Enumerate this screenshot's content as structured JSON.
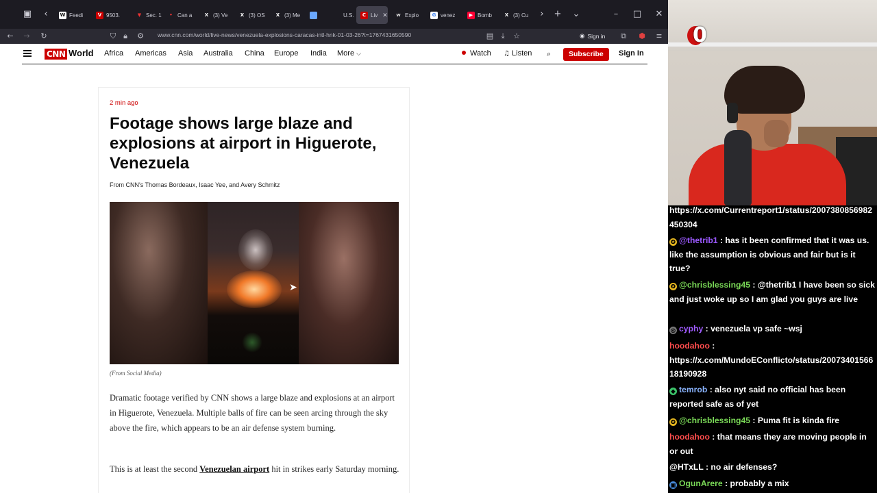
{
  "tabs": [
    {
      "label": "Feedi",
      "fav": "W",
      "color": "#ffffff",
      "fg": "#111"
    },
    {
      "label": "9503.",
      "fav": "V",
      "color": "#cc0000",
      "fg": "#fff"
    },
    {
      "label": "Sec. 1",
      "fav": "▼",
      "color": "#1c1b22",
      "fg": "#e33"
    },
    {
      "label": "Can a",
      "fav": "•",
      "color": "#1c1b22",
      "fg": "#e33"
    },
    {
      "label": "(3) Ve",
      "fav": "X",
      "color": "#1c1b22",
      "fg": "#fff"
    },
    {
      "label": "(3) OS",
      "fav": "X",
      "color": "#1c1b22",
      "fg": "#fff"
    },
    {
      "label": "(3) Me",
      "fav": "X",
      "color": "#1c1b22",
      "fg": "#fff"
    },
    {
      "label": "",
      "fav": "",
      "color": "#6aa8ff",
      "fg": "#fff"
    },
    {
      "label": "U.S. la",
      "fav": "",
      "color": "#1c1b22",
      "fg": "#fff"
    },
    {
      "label": "Liv",
      "fav": "C",
      "color": "#cc0000",
      "fg": "#fff"
    },
    {
      "label": "Explo",
      "fav": "w",
      "color": "#1c1b22",
      "fg": "#ddd"
    },
    {
      "label": "venez",
      "fav": "G",
      "color": "#ffffff",
      "fg": "#4285f4"
    },
    {
      "label": "Bomb",
      "fav": "▶",
      "color": "#ff0033",
      "fg": "#fff"
    },
    {
      "label": "(3) Cu",
      "fav": "X",
      "color": "#1c1b22",
      "fg": "#fff"
    }
  ],
  "url": "www.cnn.com/world/live-news/venezuela-explosions-caracas-intl-hnk-01-03-26?t=1767431650590",
  "browser_signin": "Sign in",
  "nav": {
    "logo": "CNN",
    "section": "World",
    "links": [
      "Africa",
      "Americas",
      "Asia",
      "Australia",
      "China",
      "Europe",
      "India",
      "More"
    ],
    "watch": "Watch",
    "listen": "Listen",
    "subscribe": "Subscribe",
    "sign_in": "Sign In"
  },
  "article": {
    "timestamp": "2 min ago",
    "headline": "Footage shows large blaze and explosions at airport in Higuerote, Venezuela",
    "byline": "From CNN's Thomas Bordeaux, Isaac Yee, and Avery Schmitz",
    "caption": "(From Social Media)",
    "para1": "Dramatic footage verified by CNN shows a large blaze and explosions at an airport in Higuerote, Venezuela. Multiple balls of fire can be seen arcing through the sky above the fire, which appears to be an air defense system burning.",
    "para2_pre": "This is at least the second ",
    "para2_link": "Venezuelan airport",
    "para2_post": " hit in strikes early Saturday morning."
  },
  "stream": {
    "counter": "0",
    "chat": [
      {
        "user": "",
        "color": "#ffffff",
        "badge": "",
        "text": "https://x.com/Currentreport1/status/2007380856982450304"
      },
      {
        "user": "@thetrib1",
        "color": "#9b59ff",
        "badge": "gold",
        "text": "has it been confirmed that it was us. like the assumption is obvious and fair but is it true?"
      },
      {
        "user": "@chrisblessing45",
        "color": "#7ad957",
        "badge": "gold",
        "text": "@thetrib1 I have been so sick and just woke up so I am glad you guys are live"
      },
      {
        "user": "cyphy",
        "color": "#a05cff",
        "badge": "grey",
        "text": "venezuela vp safe ~wsj"
      },
      {
        "user": "hoodahoo",
        "color": "#ff4d4d",
        "badge": "",
        "text": "https://x.com/MundoEConflicto/status/2007340156618190928"
      },
      {
        "user": "temrob",
        "color": "#8ab4ff",
        "badge": "green",
        "text": "also nyt said no official has been reported safe as of yet"
      },
      {
        "user": "@chrisblessing45",
        "color": "#7ad957",
        "badge": "gold",
        "text": "Puma fit is kinda fire"
      },
      {
        "user": "hoodahoo",
        "color": "#ff4d4d",
        "badge": "",
        "text": "that means they are moving people in or out"
      },
      {
        "user": "@HTxLL",
        "color": "#ffffff",
        "badge": "",
        "text": "no air defenses?"
      },
      {
        "user": "OgunArere",
        "color": "#7ad957",
        "badge": "blue",
        "text": "probably a mix"
      }
    ]
  }
}
